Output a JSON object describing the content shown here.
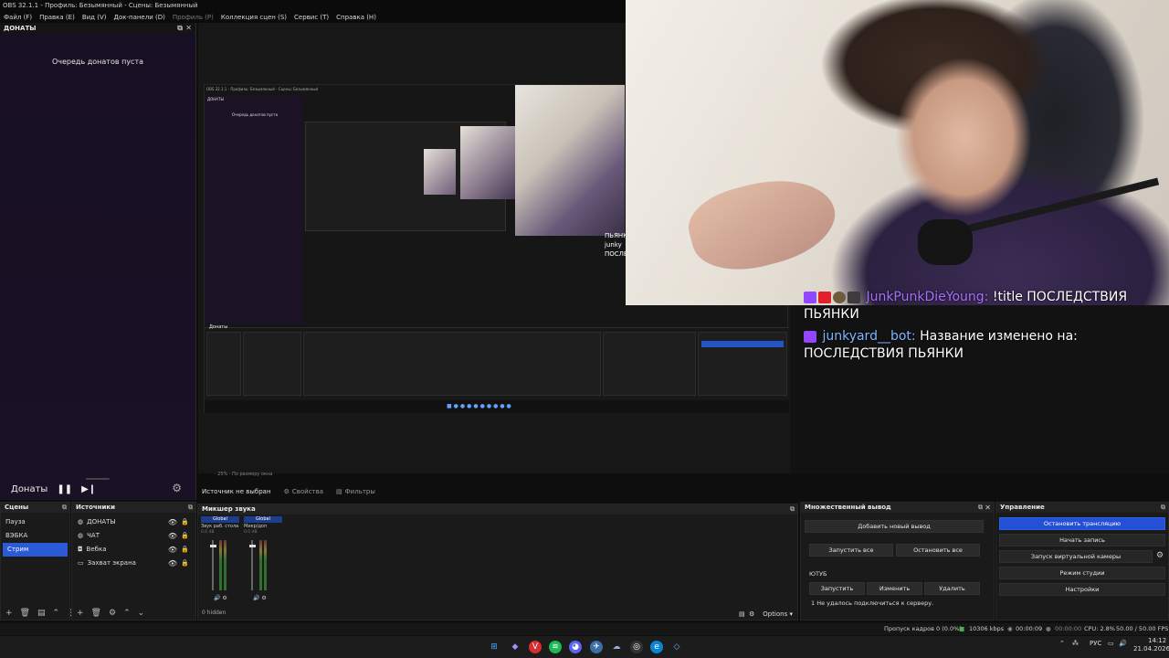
{
  "window": {
    "title": "OBS 32.1.1 - Профиль: Безымянный - Сцены: Безымянный"
  },
  "menu": [
    "Файл (F)",
    "Правка (E)",
    "Вид (V)",
    "Док-панели (D)",
    "Профиль (P)",
    "Коллекция сцен (S)",
    "Сервис (T)",
    "Справка (H)"
  ],
  "donations": {
    "title": "ДОНАТЫ",
    "empty": "Очередь донатов пуста",
    "footer_label": "Донаты"
  },
  "chat": {
    "messages": [
      {
        "user": "JunkPunkDieYoung:",
        "text": "!title ПОСЛЕДСТВИЯ ПЬЯНКИ"
      },
      {
        "user": "junkyard__bot:",
        "text": "Название изменено на: ПОСЛЕДСТВИЯ ПЬЯНКИ"
      }
    ]
  },
  "nested": {
    "title": "OBS 32.1.1 - Профиль: Безымянный - Сцены: Безымянный",
    "dock_title": "ДОНАТЫ",
    "empty": "Очередь донатов пуста",
    "chat1": "ПЬЯНКИ",
    "chat2": "junky",
    "chat3": "ПОСЛЕ",
    "donations_label": "Донаты"
  },
  "preview_status": "  ·  25%  ·  По размеру окна",
  "sourcebar": {
    "no_source": "Источник не выбран",
    "properties": "Свойства",
    "filters": "Фильтры"
  },
  "scenes": {
    "title": "Сцены",
    "items": [
      "Пауза",
      "ВЭБКА",
      "Стрим"
    ],
    "active_index": 2
  },
  "sources": {
    "title": "Источники",
    "items": [
      {
        "label": "ДОНАТЫ",
        "icon": "browser-icon"
      },
      {
        "label": "ЧАТ",
        "icon": "browser-icon"
      },
      {
        "label": "Вебка",
        "icon": "camera-icon"
      },
      {
        "label": "Захват экрана",
        "icon": "monitor-icon"
      }
    ]
  },
  "mixer": {
    "title": "Микшер звука",
    "strips": [
      {
        "name": "Global",
        "sub": "Звук раб. стола",
        "db": "0.0 dB"
      },
      {
        "name": "Global",
        "sub": "Микр/доп",
        "db": "0.0 dB"
      }
    ],
    "hidden": "0 hidden",
    "options": "Options"
  },
  "multi": {
    "title": "Множественный вывод",
    "add": "Добавить новый вывод",
    "start_all": "Запустить все",
    "stop_all": "Остановить все",
    "section": "ЮТУБ",
    "start": "Запустить",
    "edit": "Изменить",
    "delete": "Удалить",
    "error": "1 Не удалось подключиться к серверу."
  },
  "controls": {
    "title": "Управление",
    "stop_stream": "Остановить трансляцию",
    "start_record": "Начать запись",
    "virtual_cam": "Запуск виртуальной камеры",
    "studio_mode": "Режим студии",
    "settings": "Настройки"
  },
  "status": {
    "dropped": "Пропуск кадров 0 (0.0%)",
    "bitrate": "10306 kbps",
    "stream_time": "00:00:09",
    "rec_time": "00:00:00",
    "cpu": "CPU: 2.8%",
    "fps": "50.00 / 50.00 FPS"
  },
  "taskbar": {
    "lang": "РУС",
    "time": "14:12",
    "date": "21.04.2026"
  },
  "colors": {
    "accent": "#2a5ad8",
    "twitch": "#9146ff",
    "user1": "#a970ff",
    "user2": "#7fb6ff"
  }
}
